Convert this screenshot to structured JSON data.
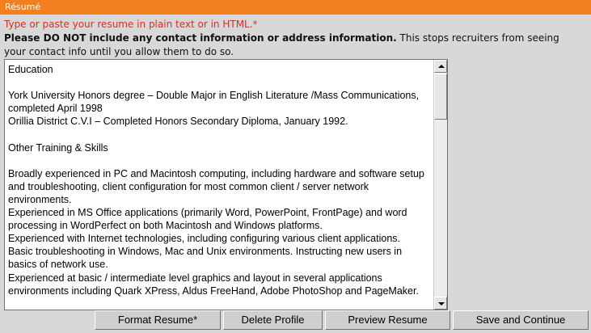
{
  "header": {
    "title": "Résumé"
  },
  "instructions": {
    "required_prompt": "Type or paste your resume in plain text or in HTML.*",
    "warning_bold": "Please DO NOT include any contact information or address information.",
    "warning_rest": " This stops recruiters from seeing your contact info until you allow them to do so."
  },
  "resume": {
    "text": "Education\n\nYork University Honors degree – Double Major in English Literature /Mass Communications, completed April 1998\nOrillia District C.V.I – Completed Honors Secondary Diploma, January 1992.\n\nOther Training & Skills\n\nBroadly experienced in PC and Macintosh computing, including hardware and software setup and troubleshooting, client configuration for most common client / server network environments.\nExperienced in MS Office applications (primarily Word, PowerPoint, FrontPage) and word processing in WordPerfect on both Macintosh and Windows platforms.\nExperienced with Internet technologies, including configuring various client applications. Basic troubleshooting in Windows, Mac and Unix environments. Instructing new users in basics of network use.\nExperienced at basic / intermediate level graphics and layout in several applications environments including Quark XPress, Aldus FreeHand, Adobe PhotoShop and PageMaker."
  },
  "buttons": {
    "format": "Format Resume*",
    "delete": "Delete Profile",
    "preview": "Preview Resume",
    "save": "Save and Continue"
  },
  "colors": {
    "header_bg": "#f47f1f",
    "required_text": "#e52a1f",
    "page_bg": "#d8d8d8"
  }
}
